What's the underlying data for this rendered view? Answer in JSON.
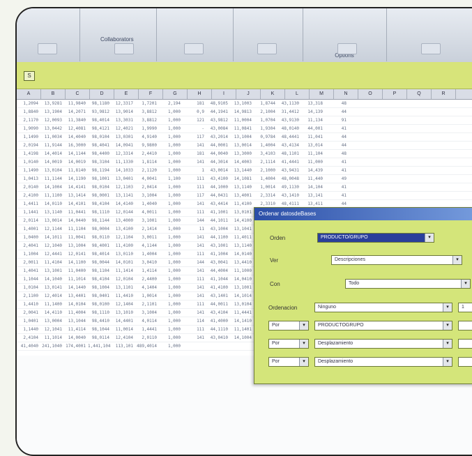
{
  "ribbon": {
    "group_title": "Collaborators",
    "groups": [
      "",
      "",
      "",
      "",
      "Options",
      ""
    ]
  },
  "formula_bar": {
    "name_box": "S"
  },
  "grid": {
    "columns": [
      "A",
      "B",
      "C",
      "D",
      "E",
      "F",
      "G",
      "H",
      "I",
      "J",
      "K",
      "L",
      "M",
      "N",
      "O",
      "P",
      "Q",
      "R"
    ],
    "rows": [
      [
        "1,2094",
        "13,9281",
        "11,9840",
        "98,1180",
        "12,3317",
        "1,7201",
        "2,194",
        "181",
        "48,9105",
        "13,1003",
        "1,8744",
        "43,1130",
        "13,318",
        "48"
      ],
      [
        "1,8840",
        "13,1904",
        "14,2071",
        "93,9812",
        "13,9014",
        "3,8812",
        "1,000",
        "0,9",
        "44,1941",
        "14,9813",
        "2,1004",
        "31,4412",
        "14,139",
        "44"
      ],
      [
        "2,1170",
        "12,0093",
        "11,3840",
        "98,4014",
        "13,3031",
        "3,8812",
        "1,000",
        "121",
        "43,9812",
        "11,0004",
        "1,0704",
        "43,9130",
        "11,134",
        "91"
      ],
      [
        "1,9090",
        "13,0442",
        "12,4081",
        "98,4121",
        "12,4021",
        "1,9990",
        "1,000",
        "-",
        "43,0084",
        "11,0841",
        "1,9304",
        "48,0140",
        "44,001",
        "41"
      ],
      [
        "1,1490",
        "11,0034",
        "14,4040",
        "98,0104",
        "13,0301",
        "4,9140",
        "1,000",
        "117",
        "43,2014",
        "13,1004",
        "0,9784",
        "48,4441",
        "11,041",
        "44"
      ],
      [
        "2,0194",
        "11,9144",
        "16,3000",
        "98,4041",
        "14,0941",
        "9,9800",
        "1,000",
        "141",
        "44,0001",
        "13,0014",
        "1,4004",
        "43,4134",
        "13,014",
        "44"
      ],
      [
        "1,4198",
        "14,4014",
        "14,1144",
        "98,4400",
        "12,3314",
        "2,4410",
        "1,000",
        "181",
        "44,0040",
        "13,3000",
        "3,4103",
        "48,1101",
        "11,104",
        "48"
      ],
      [
        "1,0140",
        "14,0019",
        "14,0019",
        "98,3104",
        "11,1330",
        "1,8114",
        "1,000",
        "141",
        "44,3014",
        "14,4003",
        "2,1114",
        "41,4441",
        "11,000",
        "41"
      ],
      [
        "1,1490",
        "13,0104",
        "11,8140",
        "98,1194",
        "14,1033",
        "2,1120",
        "1,000",
        "1",
        "43,0014",
        "13,1440",
        "2,1000",
        "43,9431",
        "14,439",
        "41"
      ],
      [
        "1,0413",
        "11,1144",
        "14,1190",
        "98,1001",
        "13,0401",
        "4,0041",
        "1,100",
        "111",
        "43,4100",
        "14,1081",
        "1,4004",
        "48,0048",
        "11,440",
        "49"
      ],
      [
        "2,0140",
        "14,1004",
        "14,4141",
        "98,0104",
        "12,1103",
        "2,0414",
        "1,000",
        "111",
        "44,1000",
        "13,1140",
        "1,0014",
        "49,1130",
        "14,104",
        "41"
      ],
      [
        "2,4100",
        "11,1100",
        "13,1414",
        "98,0001",
        "13,1141",
        "3,1004",
        "1,000",
        "117",
        "44,0431",
        "13,4001",
        "2,3314",
        "43,1410",
        "13,141",
        "41"
      ],
      [
        "1,4411",
        "14,0110",
        "14,4101",
        "98,4104",
        "14,4140",
        "1,4040",
        "1,000",
        "141",
        "43,4414",
        "11,4100",
        "2,3310",
        "48,4111",
        "13,411",
        "44"
      ],
      [
        "1,1441",
        "13,1140",
        "11,0441",
        "98,1110",
        "12,0144",
        "4,0011",
        "1,000",
        "111",
        "41,1001",
        "13,0101",
        "3,0141",
        "49,4004",
        "14,000",
        "44"
      ],
      [
        "2,0114",
        "13,0014",
        "14,0440",
        "98,1144",
        "13,4000",
        "3,1001",
        "1,000",
        "144",
        "44,1011",
        "14,4100",
        "1,4003",
        "41,0141",
        "13,100",
        "49"
      ],
      [
        "1,4001",
        "12,1144",
        "11,1104",
        "98,0004",
        "13,4100",
        "2,1414",
        "1,000",
        "11",
        "43,1004",
        "13,1041",
        "3,4110",
        "43,1110",
        "13,010",
        "44"
      ],
      [
        "1,0400",
        "14,1011",
        "11,0041",
        "98,0110",
        "12,1104",
        "3,0011",
        "1,000",
        "141",
        "44,1100",
        "11,4011",
        "2,0014",
        "44,4011",
        "13,104",
        "41"
      ],
      [
        "2,4041",
        "12,1040",
        "13,1004",
        "98,4001",
        "11,4100",
        "4,1144",
        "1,000",
        "141",
        "43,1001",
        "13,1140",
        "1,1040",
        "48,4104",
        "11,044",
        "41"
      ],
      [
        "1,1004",
        "12,4441",
        "12,0141",
        "98,4014",
        "13,0110",
        "1,4004",
        "1,000",
        "111",
        "41,1004",
        "14,0140",
        "2,4411",
        "43,1104",
        "14,001",
        "44"
      ],
      [
        "2,0011",
        "11,4104",
        "14,1100",
        "98,0044",
        "14,0101",
        "3,0410",
        "1,000",
        "144",
        "43,0041",
        "13,4410",
        "1,1104",
        "43,1401",
        "13,101",
        "41"
      ],
      [
        "1,4041",
        "13,1001",
        "11,0400",
        "98,1104",
        "11,1414",
        "1,4114",
        "1,000",
        "141",
        "44,4004",
        "11,1000",
        "1,1041",
        "44,4001",
        "11,041",
        "44"
      ],
      [
        "1,1044",
        "14,1040",
        "11,1014",
        "98,4104",
        "12,0104",
        "2,4400",
        "1,000",
        "111",
        "41,1044",
        "14,0410",
        "3,4101",
        "49,0414",
        "14,110",
        "49"
      ],
      [
        "1,0104",
        "13,0141",
        "14,1440",
        "98,1004",
        "13,1101",
        "4,1404",
        "1,000",
        "141",
        "41,4100",
        "13,1001",
        "2,1104",
        "43,4404",
        "13,014",
        "44"
      ],
      [
        "2,1100",
        "12,4014",
        "13,4401",
        "98,0401",
        "11,4410",
        "1,0014",
        "1,000",
        "141",
        "43,1401",
        "14,1014",
        "1,4110",
        "43,0110",
        "11,440",
        "41"
      ],
      [
        "1,4410",
        "11,1400",
        "14,0104",
        "98,0100",
        "12,1404",
        "2,1101",
        "1,000",
        "111",
        "44,0011",
        "13,0104",
        "2,0110",
        "48,4014",
        "11,100",
        "41"
      ],
      [
        "2,0041",
        "14,4110",
        "11,4004",
        "98,1110",
        "13,1010",
        "3,1004",
        "1,000",
        "141",
        "43,4104",
        "11,4441",
        "1,1011",
        "49,1044",
        "14,004",
        "44"
      ],
      [
        "1,0401",
        "13,0004",
        "13,1044",
        "98,4410",
        "14,4401",
        "4,0114",
        "1,000",
        "114",
        "41,4000",
        "14,1410",
        "2,4041",
        "43,4400",
        "13,441",
        "41"
      ],
      [
        "1,1440",
        "12,1041",
        "11,4114",
        "98,1044",
        "11,0014",
        "1,4441",
        "1,000",
        "111",
        "44,1110",
        "11,1401",
        "1,0401",
        "44,1040",
        "11,114",
        "44"
      ],
      [
        "2,4104",
        "11,1014",
        "14,0040",
        "98,0114",
        "12,4104",
        "2,0110",
        "1,000",
        "141",
        "43,0410",
        "14,1004",
        "1,1014",
        "43,0101",
        "14,104",
        "49"
      ],
      [
        "41,4040",
        "241,1040",
        "174,4001",
        "1,441,104",
        "113,101",
        "489,4014",
        "1,000",
        "",
        "",
        "",
        "",
        "",
        "",
        ""
      ]
    ]
  },
  "dialog": {
    "title": "Ordenar datosdeBases",
    "rows": [
      {
        "label": "Orden",
        "value": "PRODUCTO/GRUPO",
        "selected": true
      },
      {
        "label": "Ver",
        "value": "Descripciones",
        "selected": false
      },
      {
        "label": "Con",
        "value": "Todo",
        "selected": false
      }
    ],
    "sort_label": "Ordenacion",
    "sort_rows": [
      {
        "prefix": "",
        "value": "Ninguno",
        "spin": "1"
      },
      {
        "prefix": "Por",
        "value": "PRODUCTOGRUPO",
        "spin": ""
      },
      {
        "prefix": "Por",
        "value": "Desplazamiento",
        "spin": ""
      },
      {
        "prefix": "Por",
        "value": "Desplazamiento",
        "spin": ""
      }
    ]
  },
  "colors": {
    "accent_yellow_green": "#d4e57a",
    "title_blue": "#2b4ea7",
    "frame_border": "#222222"
  }
}
